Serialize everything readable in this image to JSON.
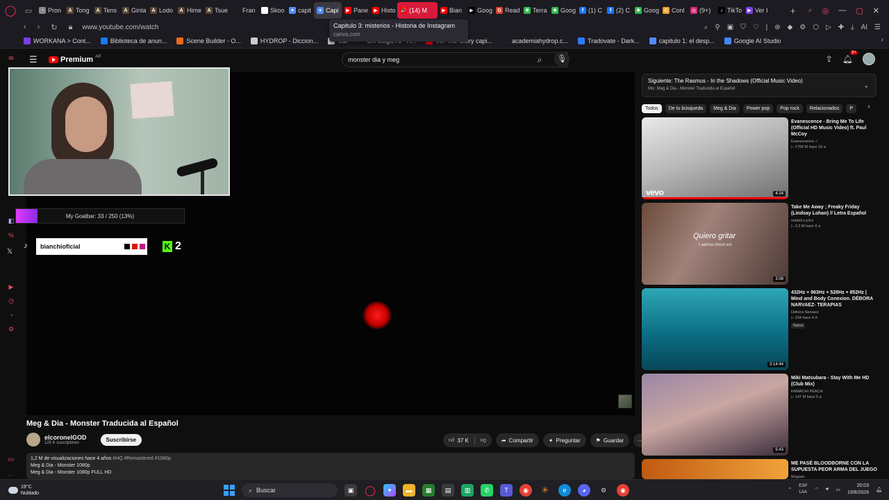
{
  "browser": {
    "tabs": [
      {
        "label": "Pron",
        "fav_color": "#888888",
        "fav": "◔"
      },
      {
        "label": "Tong",
        "fav_color": "#5a4632",
        "fav": "A"
      },
      {
        "label": "Tens",
        "fav_color": "#5a4632",
        "fav": "A"
      },
      {
        "label": "Ginta",
        "fav_color": "#5a4632",
        "fav": "A"
      },
      {
        "label": "Lodo",
        "fav_color": "#5a4632",
        "fav": "A"
      },
      {
        "label": "Hime",
        "fav_color": "#5a4632",
        "fav": "A"
      },
      {
        "label": "Tsue",
        "fav_color": "#5a4632",
        "fav": "A"
      },
      {
        "label": "Fran",
        "fav_color": "#1c1b22",
        "fav": ""
      },
      {
        "label": "Skoo",
        "fav_color": "#ffffff",
        "fav": "s"
      },
      {
        "label": "capit",
        "fav_color": "#4e8cff",
        "fav": "✦"
      },
      {
        "label": "Capi",
        "fav_color": "#4e8cff",
        "fav": "✦",
        "state": "active"
      },
      {
        "label": "Pane",
        "fav_color": "#ff0000",
        "fav": "▶"
      },
      {
        "label": "Histo",
        "fav_color": "#ff0000",
        "fav": "▶"
      },
      {
        "label": "(14) M",
        "fav_color": "#ff0000",
        "fav": "🔊",
        "state": "playing"
      },
      {
        "label": "Bian",
        "fav_color": "#ff0000",
        "fav": "▶"
      },
      {
        "label": "Goog",
        "fav_color": "#000000",
        "fav": "▶"
      },
      {
        "label": "Read",
        "fav_color": "#d6452c",
        "fav": "G"
      },
      {
        "label": "Terra",
        "fav_color": "#2fb84c",
        "fav": "✱"
      },
      {
        "label": "Goog",
        "fav_color": "#2fb84c",
        "fav": "✱"
      },
      {
        "label": "(1) C",
        "fav_color": "#1877f2",
        "fav": "f"
      },
      {
        "label": "(2) C",
        "fav_color": "#1877f2",
        "fav": "f"
      },
      {
        "label": "Goog",
        "fav_color": "#2fb84c",
        "fav": "✱"
      },
      {
        "label": "Conl",
        "fav_color": "#f0a02b",
        "fav": "C"
      },
      {
        "label": "(9+)",
        "fav_color": "#d62976",
        "fav": "◎"
      },
      {
        "label": "TikTo",
        "fav_color": "#000000",
        "fav": "♪"
      },
      {
        "label": "Ver I",
        "fav_color": "#7b3fe4",
        "fav": "▶"
      }
    ],
    "tooltip": {
      "title": "Capitulo 3: misterios - Historia de Instagram",
      "subtitle": "canva.com"
    },
    "url": "www.youtube.com/watch",
    "bookmarks": [
      {
        "label": "WORKANA > Cont...",
        "color": "#7b3fe4"
      },
      {
        "label": "Biblioteca de anun...",
        "color": "#1877f2"
      },
      {
        "label": "Scene Builder - O...",
        "color": "#e86b1c"
      },
      {
        "label": "HYDROP - Diccion...",
        "color": "#cccccc"
      },
      {
        "label": "Vali",
        "color": "#cccccc"
      },
      {
        "label": "om Magic AI - A...",
        "color": "#1c1b22"
      },
      {
        "label": "Ver The Glory capi...",
        "color": "#ff0000"
      },
      {
        "label": "academiahydrop.c...",
        "color": "#1c1b22"
      },
      {
        "label": "Tradovate - Dark...",
        "color": "#2f7bff"
      },
      {
        "label": "capitulo 1: el desp...",
        "color": "#4e8cff"
      },
      {
        "label": "Google AI Studio",
        "color": "#4285f4"
      }
    ]
  },
  "youtube": {
    "brand": "Premium",
    "region": "AR",
    "search_query": "monster dia y meg",
    "notification_count": "9+"
  },
  "overlay": {
    "goal_text": "My Goalbar: 33 / 250 (13%)",
    "goal_fraction": 0.13,
    "tiktok_handle": "bianchioficial",
    "kick_count": "2",
    "handle_colors": [
      "#000000",
      "#e01010",
      "#c2187a"
    ]
  },
  "video": {
    "title": "Meg & Dia - Monster Traducida al Español",
    "channel": "elcoronelGOD",
    "subscribers": "125 K suscriptores",
    "subscribe_label": "Suscribirse",
    "likes": "37 K",
    "share_label": "Compartir",
    "ask_label": "Preguntar",
    "save_label": "Guardar",
    "views_line": "1,2 M de visualizaciones  hace 4 años",
    "hashtags": "#HQ #Remastered #1080p",
    "desc_line1": "Meg & Dia - Monster 1080p",
    "desc_line2": "Meg & Dia - Monster 1080p FULL HD"
  },
  "nextup": {
    "label": "Siguiente: The Rasmus - In the Shadows (Official Music Video)",
    "mix": "Mix: Meg & Dia - Monster Traducida al Español"
  },
  "chips": [
    "Todos",
    "De tu búsqueda",
    "Meg & Dia",
    "Power pop",
    "Pop rock",
    "Relacionados",
    "P"
  ],
  "recommendations": [
    {
      "title": "Evanescence - Bring Me To Life (Official HD Music Video) ft. Paul McCoy",
      "channel": "Evanescence ✓",
      "meta": "▷ 1768 M  hace 16 a",
      "duration": "4:14",
      "vevo": "vevo"
    },
    {
      "title": "Take Me Away ; Freaky Friday (Lindsay Lohan) // Letra Español",
      "channel": "nubelü Lyrics",
      "meta": "▷ 2,3 M  hace 6 a",
      "duration": "3:08",
      "caption": "Quiero gritar",
      "caption2": "I wanna shout out"
    },
    {
      "title": "432Hz + 963Hz + 528Hz + 852Hz | Mind and Body Conexion. DÉBORA NARVAEZ- TERAPIAS",
      "channel": "Débora Narvaez",
      "meta": "▷ 234  hace 4 d",
      "duration": "3:14:44",
      "badge": "Nuevo"
    },
    {
      "title": "Miki Matsubara - Stay With Me HD (Club Mix)",
      "channel": "KAMACHI PEACH",
      "meta": "▷ 147 M  hace 5 a",
      "duration": "5:43"
    },
    {
      "title": "ME PASÉ BLOODBORNE CON LA SUPUESTA PEOR ARMA DEL JUEGO",
      "channel": "Mugaax",
      "meta": "",
      "duration": ""
    }
  ],
  "taskbar": {
    "temp": "19°C",
    "weather": "Nublado",
    "search_label": "Buscar",
    "lang1": "ESP",
    "lang2": "LAA",
    "time": "20:03",
    "date": "19/8/2026"
  }
}
